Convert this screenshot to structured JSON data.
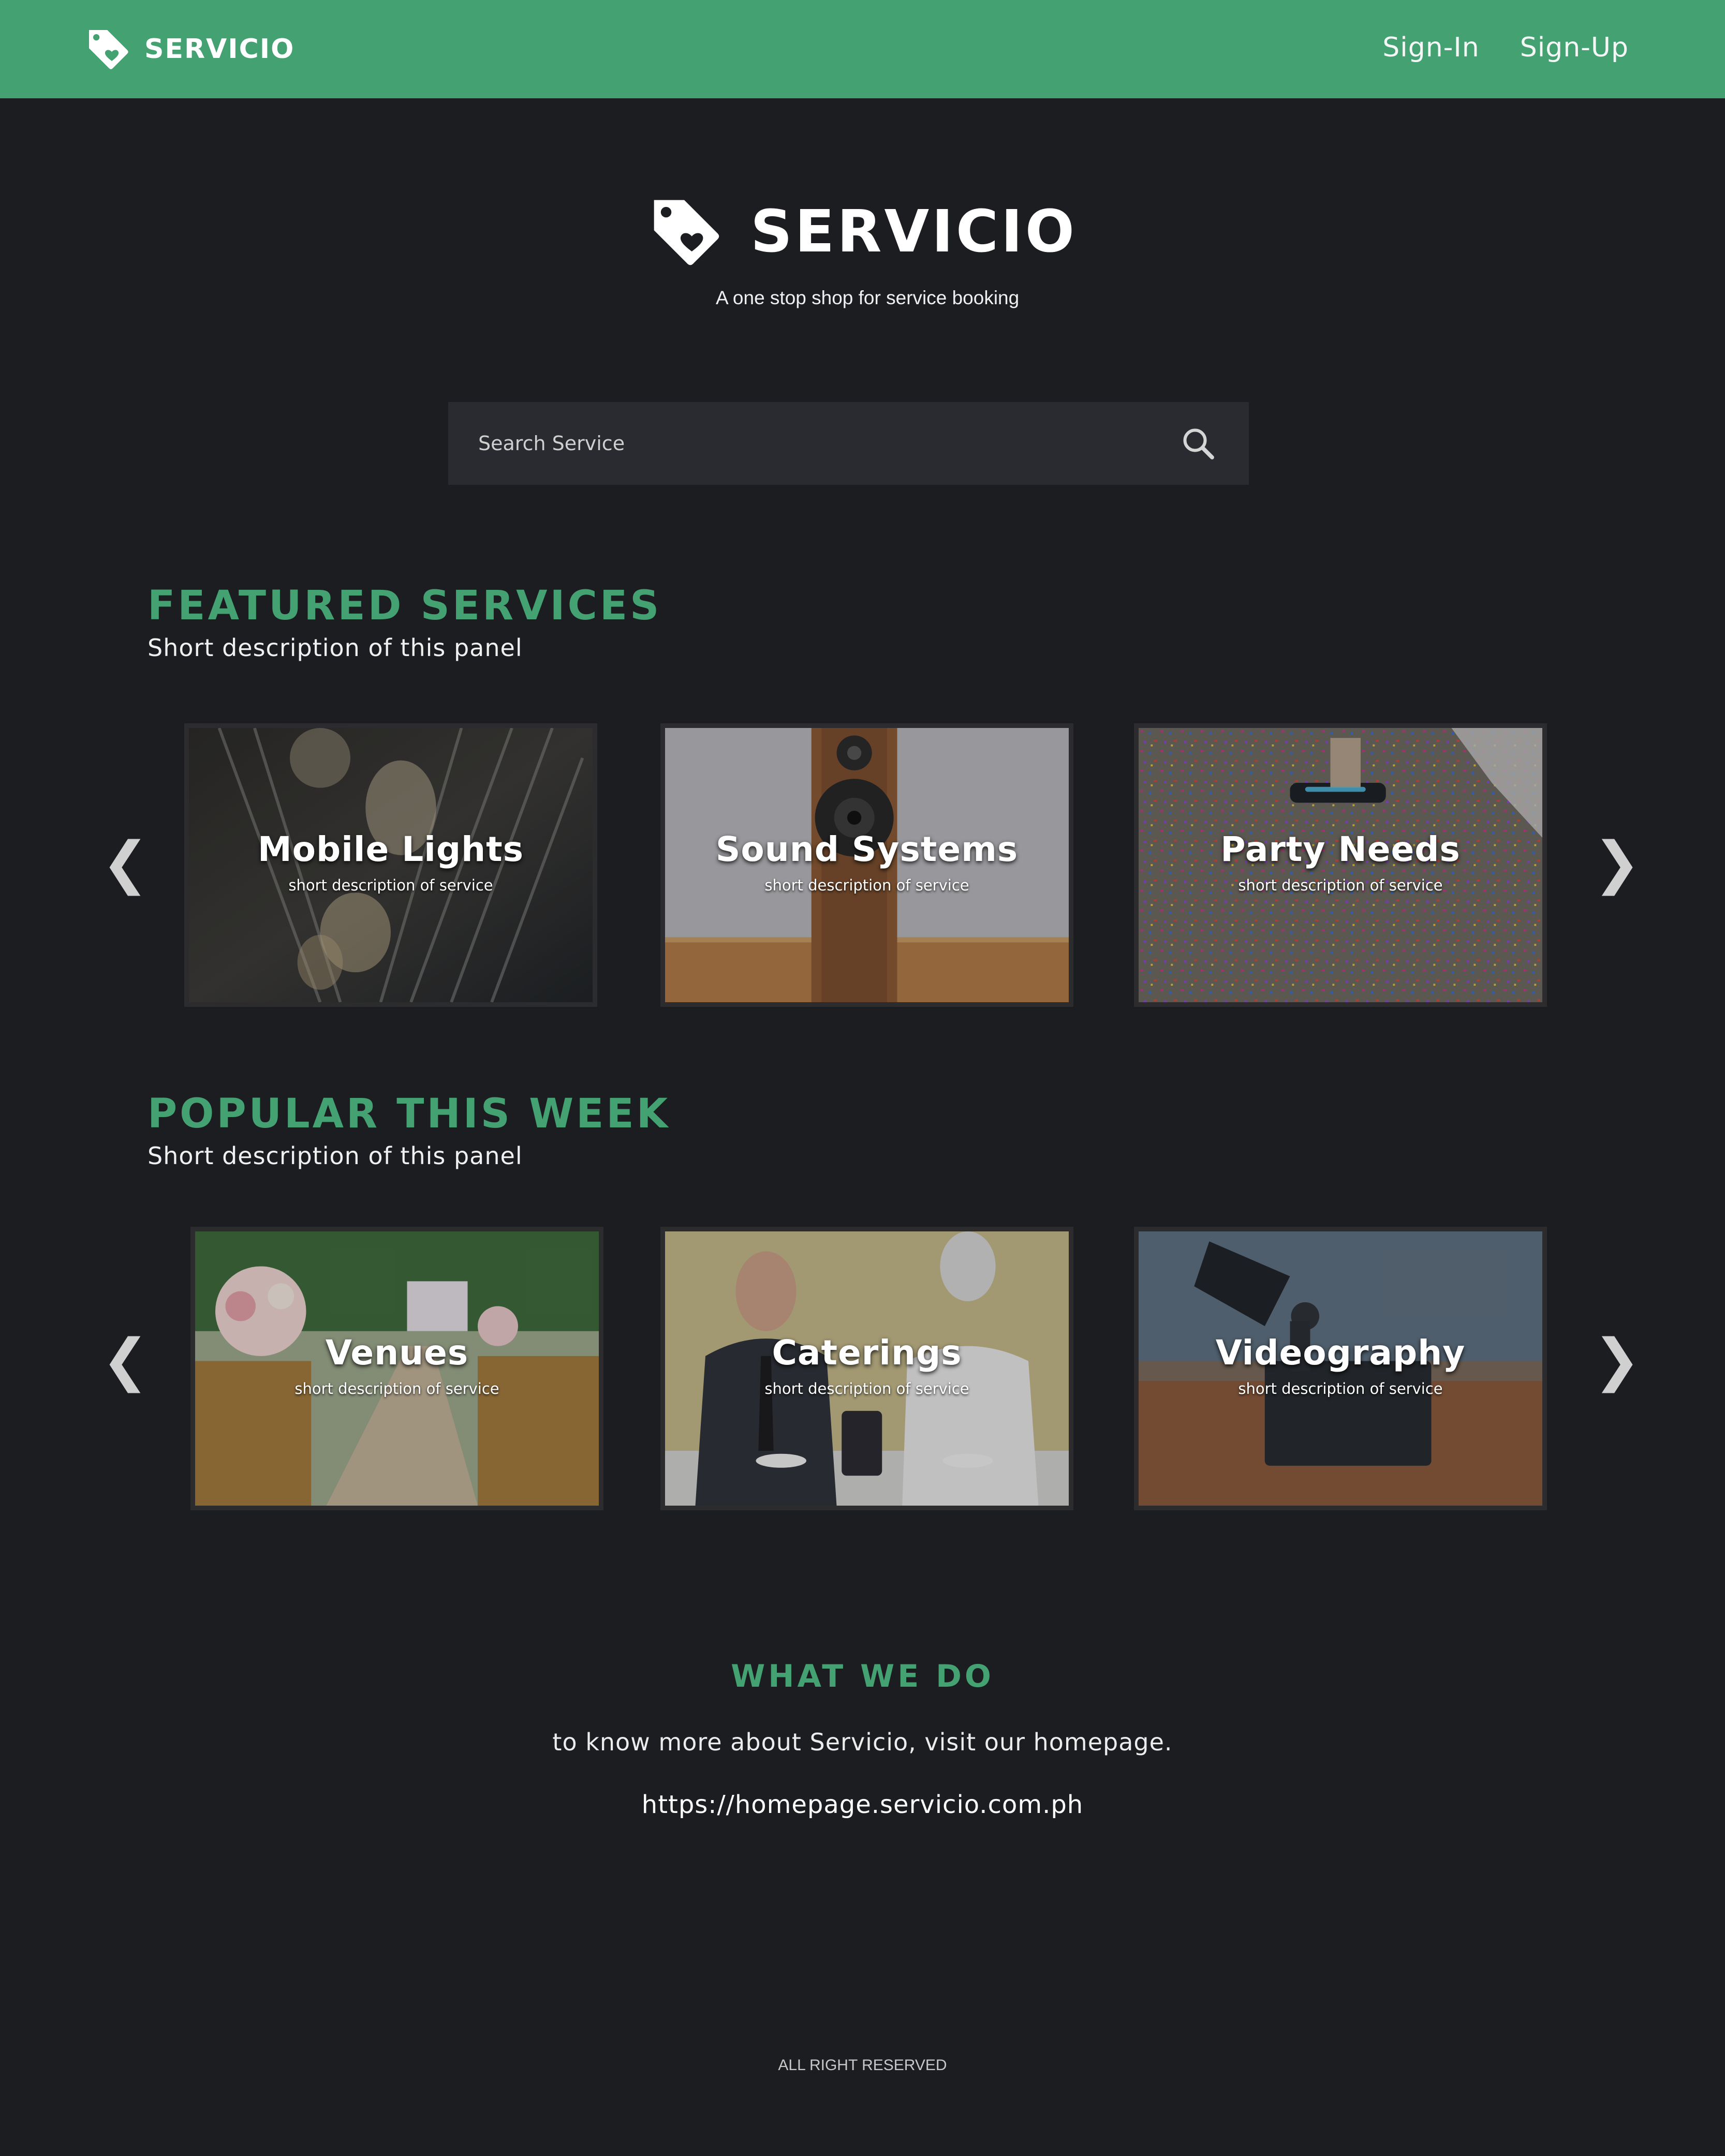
{
  "navbar": {
    "brand": "SERVICIO",
    "brand_color": "#43a172",
    "links": [
      {
        "label": "Sign-In"
      },
      {
        "label": "Sign-Up"
      }
    ]
  },
  "hero": {
    "logo_icon": "tag-heart-icon",
    "title": "SERVICIO",
    "tagline": "A one stop shop for service booking"
  },
  "search": {
    "placeholder": "Search Service",
    "icon": "search-icon"
  },
  "featured": {
    "title": "FEATURED SERVICES",
    "description": "Short description of this panel",
    "prev_arrow": "❮",
    "next_arrow": "❯",
    "cards": [
      {
        "title": "Mobile Lights",
        "description": "short description of service"
      },
      {
        "title": "Sound Systems",
        "description": "short description of service"
      },
      {
        "title": "Party Needs",
        "description": "short description of service"
      }
    ]
  },
  "popular": {
    "title": "POPULAR THIS WEEK",
    "description": "Short description of this panel",
    "prev_arrow": "❮",
    "next_arrow": "❯",
    "cards": [
      {
        "title": "Venues",
        "description": "short description of service"
      },
      {
        "title": "Caterings",
        "description": "short description of service"
      },
      {
        "title": "Videography",
        "description": "short description of service"
      }
    ]
  },
  "what_we_do": {
    "title": "WHAT WE DO",
    "text": "to know more about Servicio, visit our homepage.",
    "link": "https://homepage.servicio.com.ph"
  },
  "footer": {
    "text": "ALL RIGHT RESERVED"
  },
  "colors": {
    "accent": "#43a172",
    "background": "#1c1d21",
    "search_bg": "#2a2b31"
  }
}
